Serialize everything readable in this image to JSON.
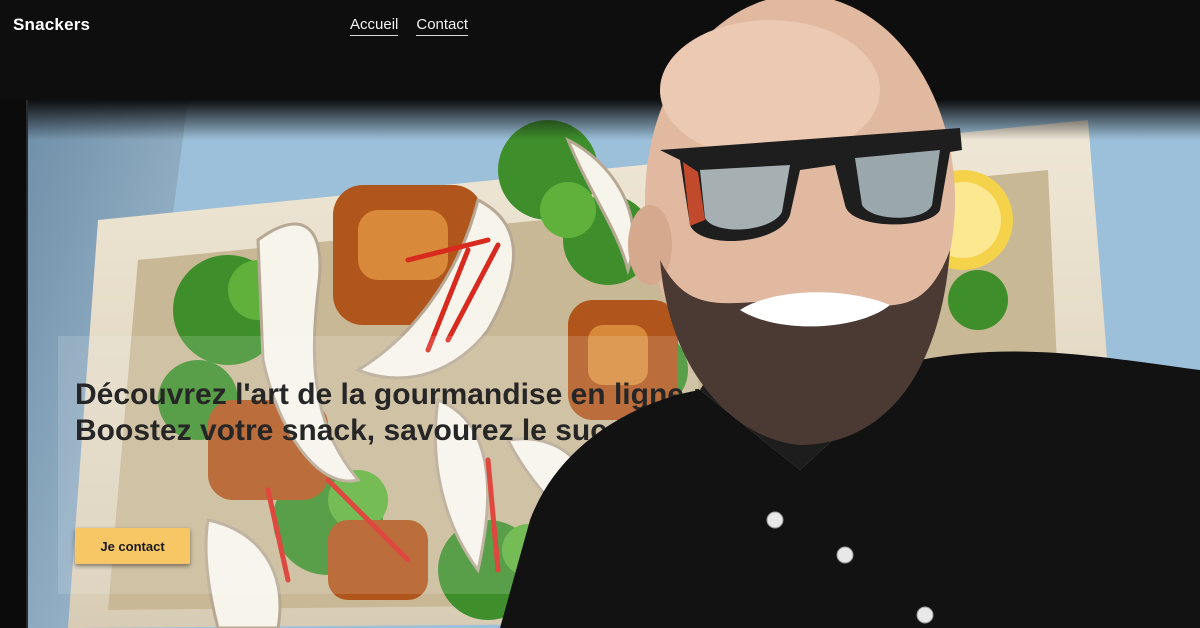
{
  "header": {
    "brand": "Snackers",
    "nav": [
      {
        "label": "Accueil"
      },
      {
        "label": "Contact"
      }
    ]
  },
  "hero": {
    "headline": "Découvrez l'art de la gourmandise en ligne : Boostez votre snack, savourez le succès !",
    "cta_label": "Je contact"
  },
  "colors": {
    "topbar": "#0e0e0e",
    "cta_background": "#f7c766",
    "headline_text": "#262626",
    "nav_text": "#f2f2f2"
  }
}
